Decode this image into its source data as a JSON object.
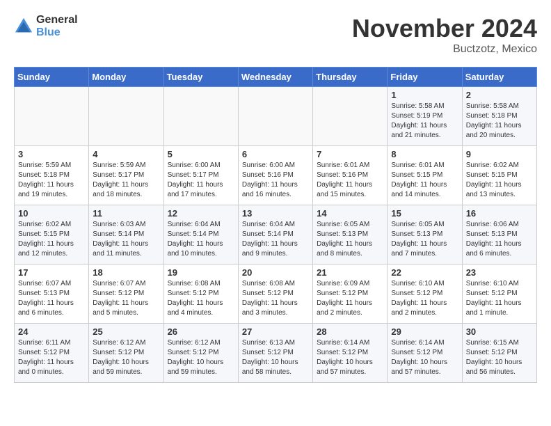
{
  "logo": {
    "general": "General",
    "blue": "Blue"
  },
  "header": {
    "month": "November 2024",
    "location": "Buctzotz, Mexico"
  },
  "weekdays": [
    "Sunday",
    "Monday",
    "Tuesday",
    "Wednesday",
    "Thursday",
    "Friday",
    "Saturday"
  ],
  "weeks": [
    [
      {
        "day": "",
        "sunrise": "",
        "sunset": "",
        "daylight": ""
      },
      {
        "day": "",
        "sunrise": "",
        "sunset": "",
        "daylight": ""
      },
      {
        "day": "",
        "sunrise": "",
        "sunset": "",
        "daylight": ""
      },
      {
        "day": "",
        "sunrise": "",
        "sunset": "",
        "daylight": ""
      },
      {
        "day": "",
        "sunrise": "",
        "sunset": "",
        "daylight": ""
      },
      {
        "day": "1",
        "sunrise": "Sunrise: 5:58 AM",
        "sunset": "Sunset: 5:19 PM",
        "daylight": "Daylight: 11 hours and 21 minutes."
      },
      {
        "day": "2",
        "sunrise": "Sunrise: 5:58 AM",
        "sunset": "Sunset: 5:18 PM",
        "daylight": "Daylight: 11 hours and 20 minutes."
      }
    ],
    [
      {
        "day": "3",
        "sunrise": "Sunrise: 5:59 AM",
        "sunset": "Sunset: 5:18 PM",
        "daylight": "Daylight: 11 hours and 19 minutes."
      },
      {
        "day": "4",
        "sunrise": "Sunrise: 5:59 AM",
        "sunset": "Sunset: 5:17 PM",
        "daylight": "Daylight: 11 hours and 18 minutes."
      },
      {
        "day": "5",
        "sunrise": "Sunrise: 6:00 AM",
        "sunset": "Sunset: 5:17 PM",
        "daylight": "Daylight: 11 hours and 17 minutes."
      },
      {
        "day": "6",
        "sunrise": "Sunrise: 6:00 AM",
        "sunset": "Sunset: 5:16 PM",
        "daylight": "Daylight: 11 hours and 16 minutes."
      },
      {
        "day": "7",
        "sunrise": "Sunrise: 6:01 AM",
        "sunset": "Sunset: 5:16 PM",
        "daylight": "Daylight: 11 hours and 15 minutes."
      },
      {
        "day": "8",
        "sunrise": "Sunrise: 6:01 AM",
        "sunset": "Sunset: 5:15 PM",
        "daylight": "Daylight: 11 hours and 14 minutes."
      },
      {
        "day": "9",
        "sunrise": "Sunrise: 6:02 AM",
        "sunset": "Sunset: 5:15 PM",
        "daylight": "Daylight: 11 hours and 13 minutes."
      }
    ],
    [
      {
        "day": "10",
        "sunrise": "Sunrise: 6:02 AM",
        "sunset": "Sunset: 5:15 PM",
        "daylight": "Daylight: 11 hours and 12 minutes."
      },
      {
        "day": "11",
        "sunrise": "Sunrise: 6:03 AM",
        "sunset": "Sunset: 5:14 PM",
        "daylight": "Daylight: 11 hours and 11 minutes."
      },
      {
        "day": "12",
        "sunrise": "Sunrise: 6:04 AM",
        "sunset": "Sunset: 5:14 PM",
        "daylight": "Daylight: 11 hours and 10 minutes."
      },
      {
        "day": "13",
        "sunrise": "Sunrise: 6:04 AM",
        "sunset": "Sunset: 5:14 PM",
        "daylight": "Daylight: 11 hours and 9 minutes."
      },
      {
        "day": "14",
        "sunrise": "Sunrise: 6:05 AM",
        "sunset": "Sunset: 5:13 PM",
        "daylight": "Daylight: 11 hours and 8 minutes."
      },
      {
        "day": "15",
        "sunrise": "Sunrise: 6:05 AM",
        "sunset": "Sunset: 5:13 PM",
        "daylight": "Daylight: 11 hours and 7 minutes."
      },
      {
        "day": "16",
        "sunrise": "Sunrise: 6:06 AM",
        "sunset": "Sunset: 5:13 PM",
        "daylight": "Daylight: 11 hours and 6 minutes."
      }
    ],
    [
      {
        "day": "17",
        "sunrise": "Sunrise: 6:07 AM",
        "sunset": "Sunset: 5:13 PM",
        "daylight": "Daylight: 11 hours and 6 minutes."
      },
      {
        "day": "18",
        "sunrise": "Sunrise: 6:07 AM",
        "sunset": "Sunset: 5:12 PM",
        "daylight": "Daylight: 11 hours and 5 minutes."
      },
      {
        "day": "19",
        "sunrise": "Sunrise: 6:08 AM",
        "sunset": "Sunset: 5:12 PM",
        "daylight": "Daylight: 11 hours and 4 minutes."
      },
      {
        "day": "20",
        "sunrise": "Sunrise: 6:08 AM",
        "sunset": "Sunset: 5:12 PM",
        "daylight": "Daylight: 11 hours and 3 minutes."
      },
      {
        "day": "21",
        "sunrise": "Sunrise: 6:09 AM",
        "sunset": "Sunset: 5:12 PM",
        "daylight": "Daylight: 11 hours and 2 minutes."
      },
      {
        "day": "22",
        "sunrise": "Sunrise: 6:10 AM",
        "sunset": "Sunset: 5:12 PM",
        "daylight": "Daylight: 11 hours and 2 minutes."
      },
      {
        "day": "23",
        "sunrise": "Sunrise: 6:10 AM",
        "sunset": "Sunset: 5:12 PM",
        "daylight": "Daylight: 11 hours and 1 minute."
      }
    ],
    [
      {
        "day": "24",
        "sunrise": "Sunrise: 6:11 AM",
        "sunset": "Sunset: 5:12 PM",
        "daylight": "Daylight: 11 hours and 0 minutes."
      },
      {
        "day": "25",
        "sunrise": "Sunrise: 6:12 AM",
        "sunset": "Sunset: 5:12 PM",
        "daylight": "Daylight: 10 hours and 59 minutes."
      },
      {
        "day": "26",
        "sunrise": "Sunrise: 6:12 AM",
        "sunset": "Sunset: 5:12 PM",
        "daylight": "Daylight: 10 hours and 59 minutes."
      },
      {
        "day": "27",
        "sunrise": "Sunrise: 6:13 AM",
        "sunset": "Sunset: 5:12 PM",
        "daylight": "Daylight: 10 hours and 58 minutes."
      },
      {
        "day": "28",
        "sunrise": "Sunrise: 6:14 AM",
        "sunset": "Sunset: 5:12 PM",
        "daylight": "Daylight: 10 hours and 57 minutes."
      },
      {
        "day": "29",
        "sunrise": "Sunrise: 6:14 AM",
        "sunset": "Sunset: 5:12 PM",
        "daylight": "Daylight: 10 hours and 57 minutes."
      },
      {
        "day": "30",
        "sunrise": "Sunrise: 6:15 AM",
        "sunset": "Sunset: 5:12 PM",
        "daylight": "Daylight: 10 hours and 56 minutes."
      }
    ]
  ]
}
